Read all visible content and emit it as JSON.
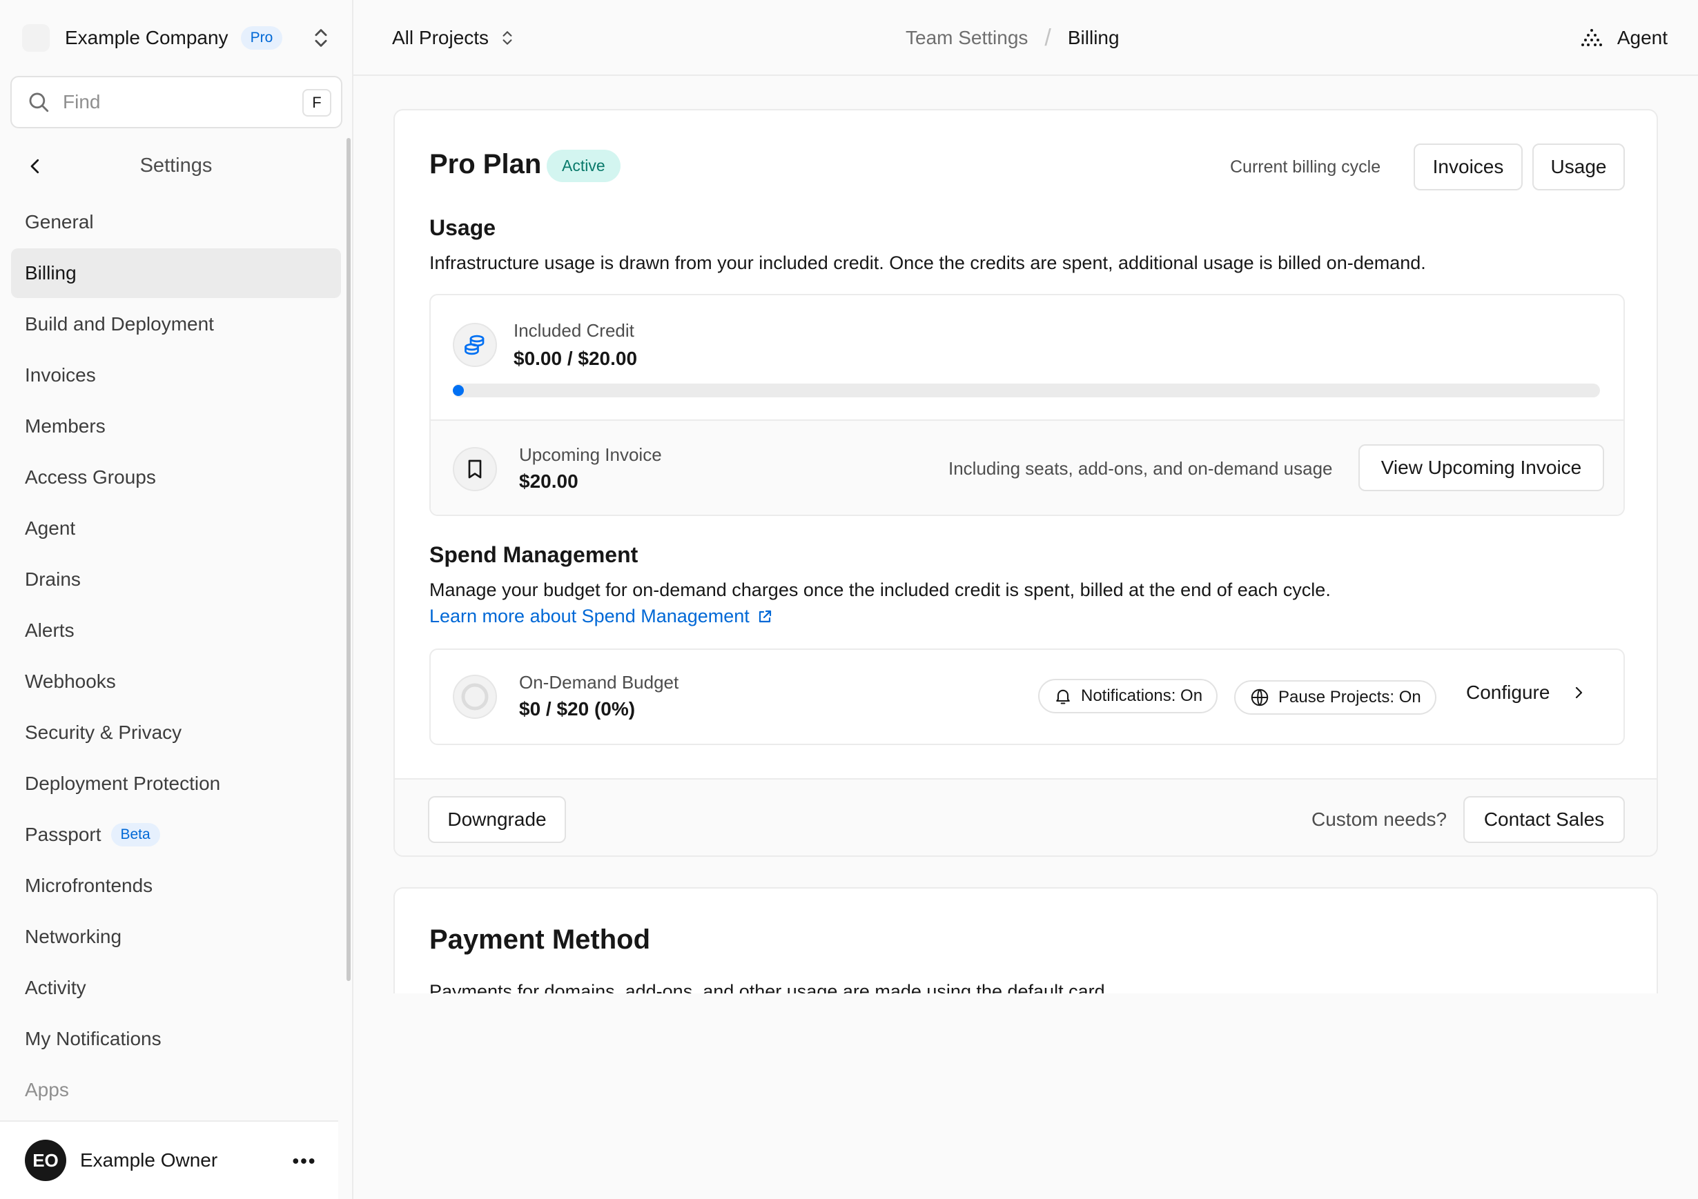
{
  "sidebar": {
    "team_name": "Example Company",
    "team_badge": "Pro",
    "find_placeholder": "Find",
    "find_shortcut": "F",
    "settings_title": "Settings",
    "items": [
      {
        "label": "General"
      },
      {
        "label": "Billing",
        "active": true
      },
      {
        "label": "Build and Deployment"
      },
      {
        "label": "Invoices"
      },
      {
        "label": "Members"
      },
      {
        "label": "Access Groups"
      },
      {
        "label": "Agent"
      },
      {
        "label": "Drains"
      },
      {
        "label": "Alerts"
      },
      {
        "label": "Webhooks"
      },
      {
        "label": "Security & Privacy"
      },
      {
        "label": "Deployment Protection"
      },
      {
        "label": "Passport",
        "badge": "Beta"
      },
      {
        "label": "Microfrontends"
      },
      {
        "label": "Networking"
      },
      {
        "label": "Activity"
      },
      {
        "label": "My Notifications"
      },
      {
        "label": "Apps"
      }
    ],
    "user": {
      "initials": "EO",
      "name": "Example Owner"
    }
  },
  "topbar": {
    "projects_label": "All Projects",
    "breadcrumb_parent": "Team Settings",
    "breadcrumb_separator": "/",
    "breadcrumb_current": "Billing",
    "agent_label": "Agent"
  },
  "plan": {
    "title": "Pro Plan",
    "status": "Active",
    "cycle_label": "Current billing cycle",
    "invoices_button": "Invoices",
    "usage_button": "Usage"
  },
  "usage": {
    "title": "Usage",
    "description": "Infrastructure usage is drawn from your included credit. Once the credits are spent, additional usage is billed on-demand.",
    "included_credit_label": "Included Credit",
    "included_credit_value": "$0.00 / $20.00",
    "included_credit_progress": 0,
    "upcoming_invoice_label": "Upcoming Invoice",
    "upcoming_invoice_value": "$20.00",
    "upcoming_invoice_note": "Including seats, add-ons, and on-demand usage",
    "view_invoice_button": "View Upcoming Invoice"
  },
  "spend": {
    "title": "Spend Management",
    "description": "Manage your budget for on-demand charges once the included credit is spent, billed at the end of each cycle.",
    "learn_more": "Learn more about Spend Management",
    "budget_label": "On-Demand Budget",
    "budget_value": "$0 / $20 (0%)",
    "notifications_pill": "Notifications: On",
    "pause_pill": "Pause Projects: On",
    "configure_label": "Configure"
  },
  "footer": {
    "downgrade_button": "Downgrade",
    "custom_needs": "Custom needs?",
    "contact_sales_button": "Contact Sales"
  },
  "payment": {
    "title": "Payment Method",
    "description": "Payments for domains, add-ons, and other usage are made using the default card."
  },
  "colors": {
    "accent": "#0070f3",
    "link": "#0068d6",
    "active_badge_bg": "#d3f5f0",
    "active_badge_text": "#0a7a6b"
  }
}
